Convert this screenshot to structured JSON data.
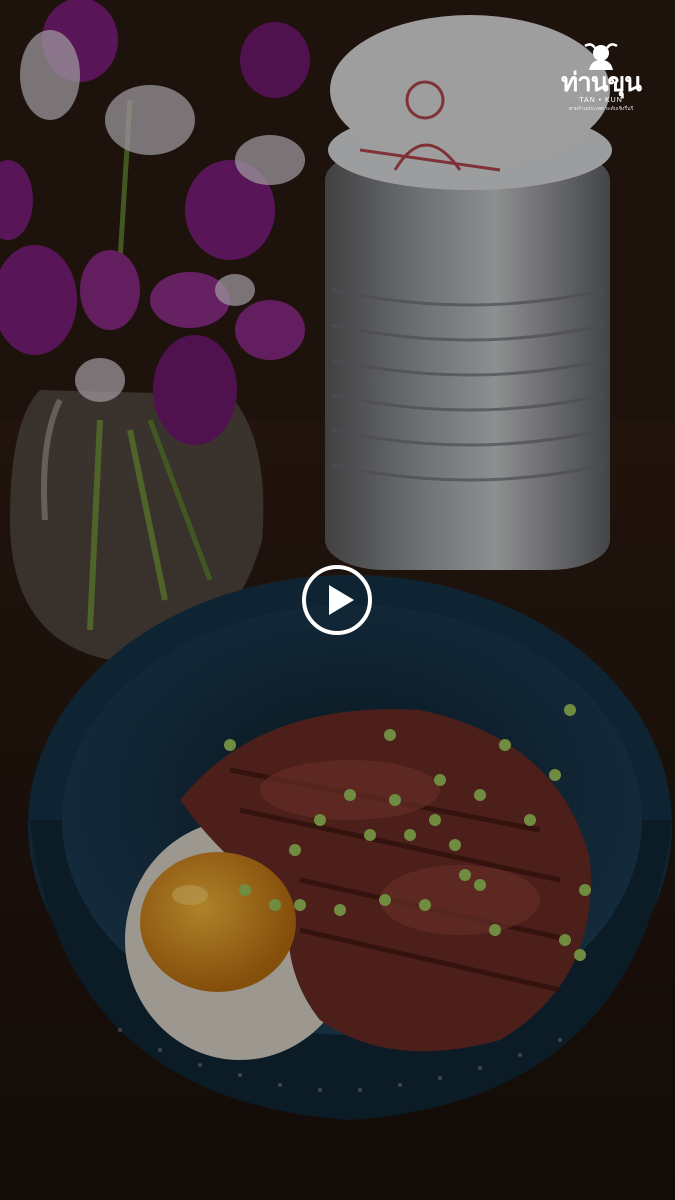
{
  "logo": {
    "brand_thai": "ท่านขุน",
    "brand_latin": "TAN • KUN",
    "tagline": "ตามร้านประเทศ ระดับเชิงรื่นรี"
  },
  "video": {
    "play_icon": "play-circle-icon"
  },
  "colors": {
    "bowl": "#163246",
    "background": "#241610",
    "orchid": "#7a1f7a"
  }
}
